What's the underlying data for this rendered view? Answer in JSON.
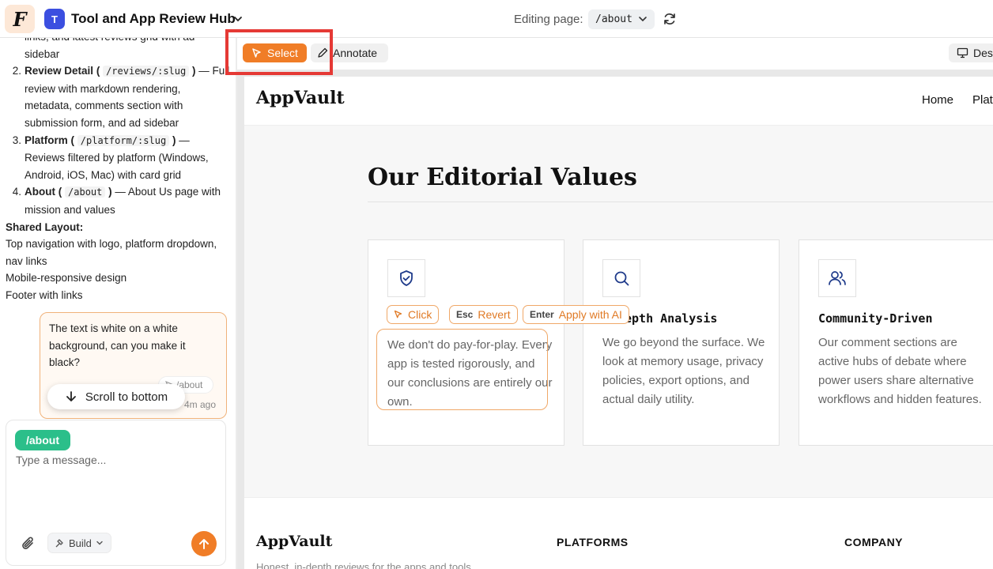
{
  "app": {
    "logo_letter": "F",
    "project_initial": "T",
    "project_name": "Tool and App Review Hub",
    "editing_label": "Editing page:",
    "current_page": "/about"
  },
  "plan": {
    "intro_frag": "links, and latest reviews grid with ad",
    "intro_frag2": "sidebar",
    "pages": [
      {
        "num": "2.",
        "name": "Review Detail",
        "route": "/reviews/:slug",
        "desc": "— Full review with markdown rendering, metadata, comments section with submission form, and ad sidebar"
      },
      {
        "num": "3.",
        "name": "Platform",
        "route": "/platform/:slug",
        "desc": "— Reviews filtered by platform (Windows, Android, iOS, Mac) with card grid"
      },
      {
        "num": "4.",
        "name": "About",
        "route": "/about",
        "desc": "— About Us page with mission and values"
      }
    ],
    "shared_heading": "Shared Layout:",
    "shared_items": [
      "Top navigation with logo, platform dropdown, nav links",
      "Mobile-responsive design",
      "Footer with links"
    ]
  },
  "chat": {
    "message": "The text is white on a white background, can you make it black?",
    "context_chip": "/about",
    "timestamp": "4m ago",
    "scroll_button": "Scroll to bottom",
    "composer_tag": "/about",
    "placeholder": "Type a message...",
    "mode_label": "Build"
  },
  "toolbar": {
    "select_label": "Select",
    "annotate_label": "Annotate",
    "device_label": "Des"
  },
  "site": {
    "logo": "AppVault",
    "nav": [
      "Home",
      "Plat"
    ],
    "heading": "Our Editorial Values",
    "cards": [
      {
        "icon": "shield-check-icon",
        "title": "",
        "body": "We don't do pay-for-play. Every app is tested rigorously, and our conclusions are entirely our own."
      },
      {
        "icon": "search-icon",
        "title": "epth Analysis",
        "body": "We go beyond the surface. We look at memory usage, privacy policies, export options, and actual daily utility."
      },
      {
        "icon": "users-icon",
        "title": "Community-Driven",
        "body": "Our comment sections are active hubs of debate where power users share alternative workflows and hidden features."
      }
    ],
    "selection_tools": {
      "click": "Click",
      "esc_key": "Esc",
      "revert": "Revert",
      "enter_key": "Enter",
      "apply": "Apply with AI"
    },
    "footer": {
      "logo": "AppVault",
      "col1": "PLATFORMS",
      "col2": "COMPANY",
      "tagline": "Honest, in-depth reviews for the apps and tools"
    }
  },
  "colors": {
    "accent": "#f07d27",
    "highlight_red": "#e53935",
    "tag_green": "#2bbf8a",
    "brand_blue": "#3b4fe0"
  }
}
